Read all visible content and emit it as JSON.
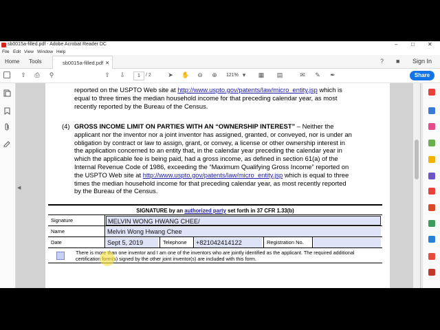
{
  "window": {
    "title": "sb0015a-filled.pdf - Adobe Acrobat Reader DC"
  },
  "menu": [
    "File",
    "Edit",
    "View",
    "Window",
    "Help"
  ],
  "tabs": {
    "home": "Home",
    "tools": "Tools",
    "document": "sb0015a-filled.pdf",
    "sign_in": "Sign In"
  },
  "toolbar": {
    "page_current": "1",
    "page_total": "/ 2",
    "zoom": "121%",
    "share": "Share"
  },
  "document": {
    "top_lines": [
      "reported on the USPTO Web site at",
      "which is",
      "equal to three times the median household income for that preceding calendar year, as most",
      "recently reported by the Bureau of the Census."
    ],
    "link_url": "http://www.uspto.gov/patents/law/micro_entity.jsp",
    "item4_number": "(4)",
    "item4_heading": "GROSS INCOME LIMIT ON PARTIES WITH AN “OWNERSHIP INTEREST”",
    "item4_heading_tail": " – Neither the",
    "item4_lines": [
      "applicant nor the inventor nor a joint inventor has assigned, granted, or conveyed, nor is under an",
      "obligation by contract or law to assign, grant, or convey, a license or other ownership interest in",
      "the application concerned to an entity that, in the calendar year preceding the calendar year in",
      "which the applicable fee is being paid, had a gross income, as defined in section 61(a) of the",
      "Internal Revenue Code of 1986, exceeding the “Maximum Qualifying Gross Income” reported on",
      "the USPTO Web site at",
      "which is equal to three",
      "times the median household income for that preceding calendar year, as most recently reported",
      "by the Bureau of the Census."
    ],
    "signature_heading_pre": "SIGNATURE by an ",
    "signature_heading_link": "authorized party",
    "signature_heading_post": " set forth in 37 CFR 1.33(b)"
  },
  "form": {
    "signature_label": "Signature",
    "signature_value": "MELVIN WONG HWANG CHEE/",
    "name_label": "Name",
    "name_value": "Melvin Wong Hwang Chee",
    "date_label": "Date",
    "date_value": "Sept 5, 2019",
    "telephone_label": "Telephone",
    "telephone_value": "+821042414122",
    "registration_label": "Registration No.",
    "registration_value": "",
    "note": "There is more than one inventor and I am one of the inventors who are jointly identified as the applicant. The required additional certification form(s) signed by the other joint inventor(s) are included with this form."
  },
  "colors": {
    "accent": "#1473e6",
    "field_fill": "#dfe3f8",
    "link": "#1a1aa6"
  }
}
